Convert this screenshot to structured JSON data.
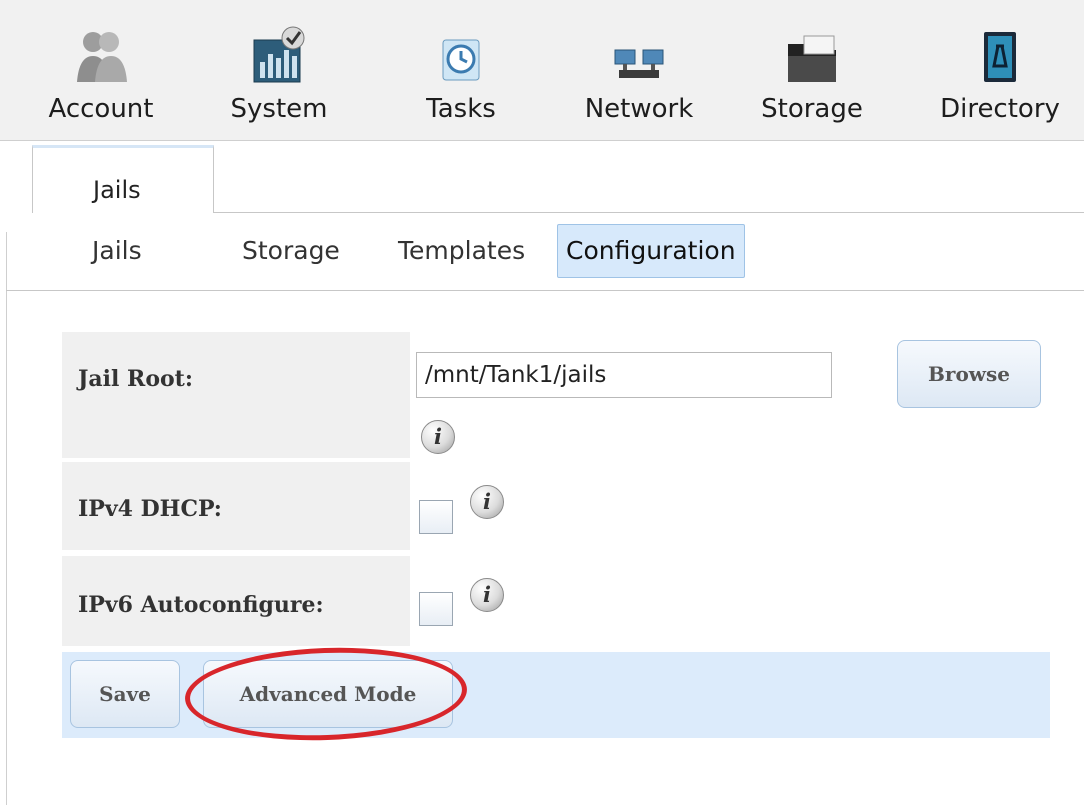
{
  "toolbar": {
    "items": [
      {
        "label": "Account",
        "icon": "account-icon"
      },
      {
        "label": "System",
        "icon": "system-icon"
      },
      {
        "label": "Tasks",
        "icon": "tasks-icon"
      },
      {
        "label": "Network",
        "icon": "network-icon"
      },
      {
        "label": "Storage",
        "icon": "storage-icon"
      },
      {
        "label": "Directory",
        "icon": "directory-icon"
      }
    ]
  },
  "main_tab": {
    "label": "Jails"
  },
  "sub_tabs": [
    {
      "label": "Jails",
      "active": false
    },
    {
      "label": "Storage",
      "active": false
    },
    {
      "label": "Templates",
      "active": false
    },
    {
      "label": "Configuration",
      "active": true
    }
  ],
  "form": {
    "jail_root": {
      "label": "Jail Root:",
      "value": "/mnt/Tank1/jails",
      "browse_label": "Browse"
    },
    "ipv4_dhcp": {
      "label": "IPv4 DHCP:",
      "checked": false
    },
    "ipv6_autoconfigure": {
      "label": "IPv6 Autoconfigure:",
      "checked": false
    },
    "info_glyph": "i"
  },
  "actions": {
    "save_label": "Save",
    "advanced_label": "Advanced Mode"
  },
  "colors": {
    "highlight_ring": "#d8262b",
    "active_tab": "#d7e9fb",
    "footer_bar": "#dcebfb"
  }
}
